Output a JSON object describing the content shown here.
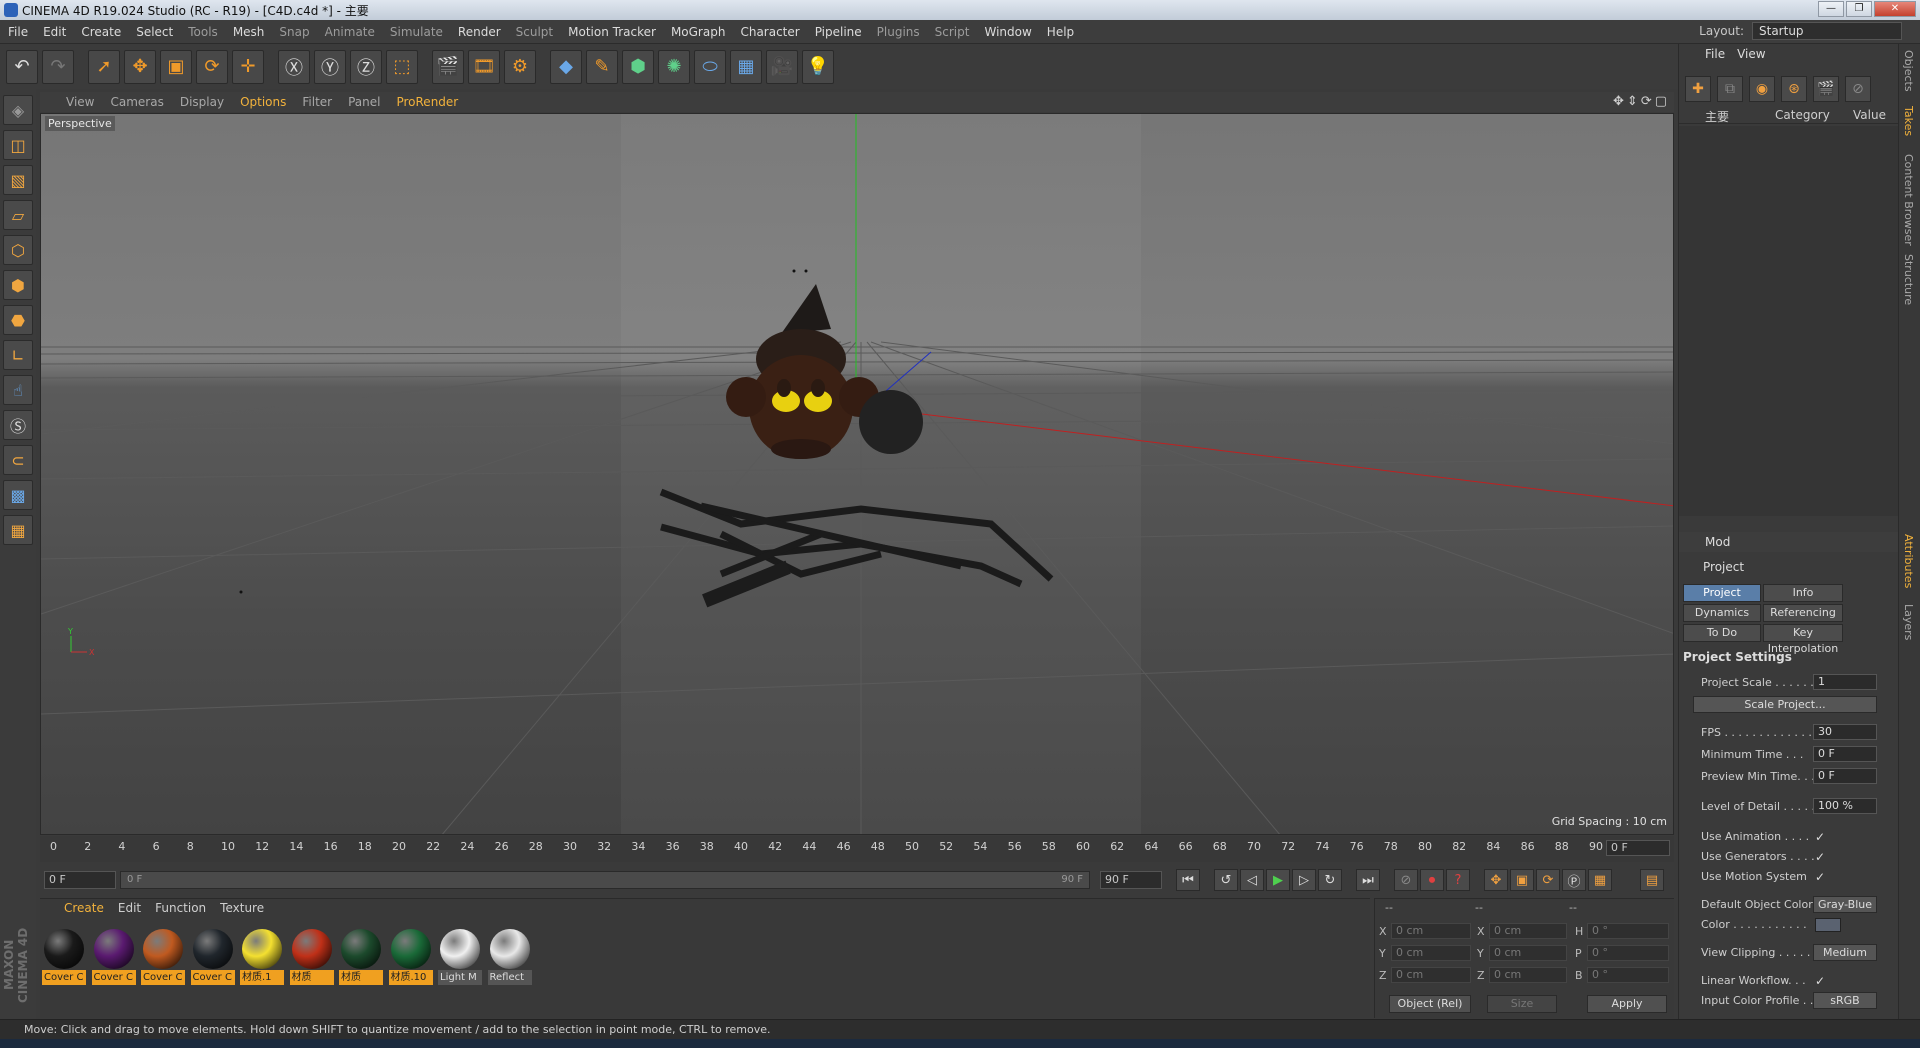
{
  "app": {
    "title": "CINEMA 4D R19.024 Studio (RC - R19) - [C4D.c4d *] - 主要",
    "window_buttons": [
      "—",
      "❐",
      "✕"
    ],
    "layout_label": "Layout:",
    "layout_value": "Startup"
  },
  "menubar": [
    "File",
    "Edit",
    "Create",
    "Select",
    "Tools",
    "Mesh",
    "Snap",
    "Animate",
    "Simulate",
    "Render",
    "Sculpt",
    "Motion Tracker",
    "MoGraph",
    "Character",
    "Pipeline",
    "Plugins",
    "Script",
    "Window",
    "Help"
  ],
  "viewport": {
    "menu": [
      "View",
      "Cameras",
      "Display",
      "Options",
      "Filter",
      "Panel",
      "ProRender"
    ],
    "active_menu": "Options",
    "label": "Perspective",
    "grid_spacing": "Grid Spacing : 10 cm"
  },
  "timeline": {
    "ticks": [
      "0",
      "2",
      "4",
      "6",
      "8",
      "10",
      "12",
      "14",
      "16",
      "18",
      "20",
      "22",
      "24",
      "26",
      "28",
      "30",
      "32",
      "34",
      "36",
      "38",
      "40",
      "42",
      "44",
      "46",
      "48",
      "50",
      "52",
      "54",
      "56",
      "58",
      "60",
      "62",
      "64",
      "66",
      "68",
      "70",
      "72",
      "74",
      "76",
      "78",
      "80",
      "82",
      "84",
      "86",
      "88",
      "90"
    ],
    "current_frame": "0 F",
    "start": "0 F",
    "slider_left": "0 F",
    "slider_right": "90 F",
    "end": "90 F"
  },
  "materials": {
    "menu": [
      "Create",
      "Edit",
      "Function",
      "Texture"
    ],
    "active_menu": "Create",
    "items": [
      {
        "label": "Cover C",
        "color": "#1a1a1a"
      },
      {
        "label": "Cover C",
        "color": "#5a1a70"
      },
      {
        "label": "Cover C",
        "color": "#c05a20"
      },
      {
        "label": "Cover C",
        "color": "#20262c"
      },
      {
        "label": "材质.1",
        "color": "#f4e030"
      },
      {
        "label": "材质",
        "color": "#c03018"
      },
      {
        "label": "材质",
        "color": "#1c4a2c"
      },
      {
        "label": "材质.10",
        "color": "#1a6a38"
      },
      {
        "label": "Light M",
        "color": "#f0f0f0"
      },
      {
        "label": "Reflect",
        "color": "#e8e8e8"
      }
    ]
  },
  "coords": {
    "headers": [
      "--",
      "--",
      "--"
    ],
    "rows": [
      {
        "a": "X",
        "av": "0 cm",
        "b": "X",
        "bv": "0 cm",
        "c": "H",
        "cv": "0 °"
      },
      {
        "a": "Y",
        "av": "0 cm",
        "b": "Y",
        "bv": "0 cm",
        "c": "P",
        "cv": "0 °"
      },
      {
        "a": "Z",
        "av": "0 cm",
        "b": "Z",
        "bv": "0 cm",
        "c": "B",
        "cv": "0 °"
      }
    ],
    "mode": "Object (Rel)",
    "size": "Size",
    "apply": "Apply"
  },
  "objects": {
    "menu": [
      "File",
      "View"
    ],
    "col_name": "主要",
    "col_category": "Category",
    "col_value": "Value"
  },
  "attributes": {
    "header": "Mod",
    "title": "Project",
    "tabs": [
      "Project Settings",
      "Info",
      "Dynamics",
      "Referencing",
      "To Do",
      "Key Interpolation"
    ],
    "section": "Project Settings",
    "scale_label": "Project Scale . . . . . .",
    "scale_value": "1",
    "scale_button": "Scale Project...",
    "fps_label": "FPS . . . . . . . . . . . . . .",
    "fps_value": "30",
    "min_time_label": "Minimum Time . . .",
    "min_time_value": "0 F",
    "preview_min_label": "Preview Min Time. . .",
    "preview_min_value": "0 F",
    "lod_label": "Level of Detail . . . . .",
    "lod_value": "100 %",
    "use_animation": "Use Animation . . . .",
    "use_generators": "Use Generators . . . .",
    "use_motion": "Use Motion System",
    "default_color_label": "Default Object Color",
    "default_color_value": "Gray-Blue",
    "color_label": "Color . . . . . . . . . . .",
    "view_clipping_label": "View Clipping . . . . .",
    "view_clipping_value": "Medium",
    "linear_workflow": "Linear Workflow. . .",
    "input_profile_label": "Input Color Profile . .",
    "input_profile_value": "sRGB",
    "check": "✓"
  },
  "side_tabs": [
    "Objects",
    "Takes",
    "Content Browser",
    "Structure",
    "Attributes",
    "Layers"
  ],
  "status": "Move: Click and drag to move elements. Hold down SHIFT to quantize movement / add to the selection in point mode, CTRL to remove."
}
